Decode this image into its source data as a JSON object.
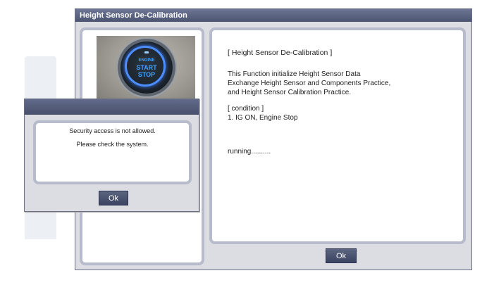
{
  "main_window": {
    "title": "Height Sensor De-Calibration",
    "image": {
      "label_top": "ENGINE",
      "label_mid": "START",
      "label_bottom": "STOP"
    },
    "content": {
      "heading": "[ Height Sensor De-Calibration ]",
      "description": [
        "This Function initialize Height Sensor Data",
        "Exchange Height Sensor and Components  Practice,",
        "and Height Sensor Calibration Practice."
      ],
      "condition_title": "[ condition ]",
      "condition_items": [
        "1. IG ON, Engine Stop"
      ],
      "status": "running.........."
    },
    "ok_label": "Ok"
  },
  "dialog": {
    "title": "",
    "messages": [
      "Security access is not allowed.",
      "Please check the system."
    ],
    "ok_label": "Ok"
  },
  "colors": {
    "titlebar": "#4f5874",
    "panel_border": "#b7bbcb",
    "window_bg": "#dcdde3",
    "button": "#4b5470",
    "engine_glow": "#4c8dff"
  }
}
